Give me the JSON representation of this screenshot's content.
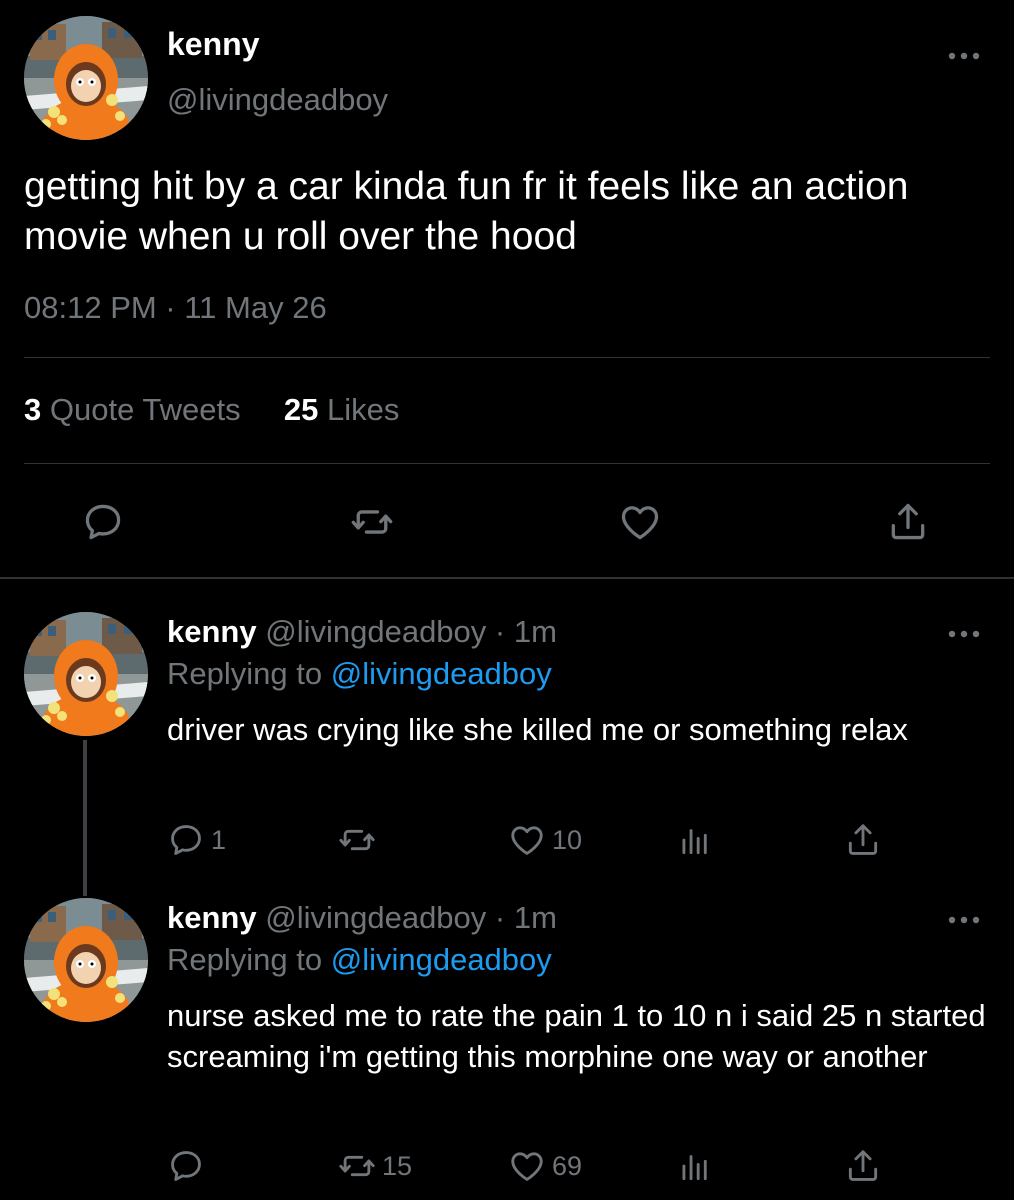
{
  "main_tweet": {
    "display_name": "kenny",
    "handle": "@livingdeadboy",
    "text": "getting hit by a car kinda fun fr it feels like an action movie when u roll over the hood",
    "timestamp": "08:12 PM · 11 May 26",
    "stats": {
      "quote_tweets_count": "3",
      "quote_tweets_label": "Quote Tweets",
      "likes_count": "25",
      "likes_label": "Likes"
    },
    "icons": [
      "reply-icon",
      "retweet-icon",
      "like-icon",
      "share-icon",
      "more-icon"
    ]
  },
  "replies": [
    {
      "display_name": "kenny",
      "meta": "@livingdeadboy · 1m",
      "replying_prefix": "Replying to",
      "replying_to": "@livingdeadboy",
      "text": "driver was crying like she killed me or something relax",
      "reply_count": "1",
      "retweet_count": "",
      "like_count": "10"
    },
    {
      "display_name": "kenny",
      "meta": "@livingdeadboy · 1m",
      "replying_prefix": "Replying to",
      "replying_to": "@livingdeadboy",
      "text": "nurse asked me to rate the pain 1 to 10 n i said 25 n started screaming i'm getting this morphine one way or another",
      "reply_count": "",
      "retweet_count": "15",
      "like_count": "69"
    }
  ],
  "colors": {
    "background": "#000000",
    "text": "#ffffff",
    "secondary": "#71767b",
    "link": "#1d9bf0",
    "divider": "#2f3336"
  }
}
